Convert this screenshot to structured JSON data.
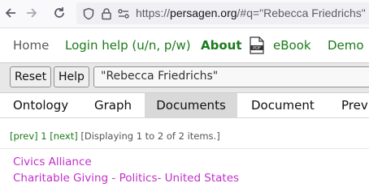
{
  "browser": {
    "url_prefix": "https://",
    "url_host": "persagen.org",
    "url_rest": "/#q=\"Rebecca Friedrichs\""
  },
  "menu": {
    "home": "Home",
    "login": "Login help (u/n, p/w)",
    "about": "About",
    "pdf_icon_text": "PDF",
    "ebook": "eBook",
    "demo": "Demo"
  },
  "search": {
    "reset_label": "Reset",
    "help_label": "Help",
    "query": "\"Rebecca Friedrichs\""
  },
  "tabs": [
    {
      "label": "Ontology"
    },
    {
      "label": "Graph"
    },
    {
      "label": "Documents",
      "active": true
    },
    {
      "label": "Document"
    },
    {
      "label": "Previ"
    }
  ],
  "pager": {
    "prev": "[prev]",
    "page": "1",
    "next": "[next]",
    "status": "[Displaying 1 to 2 of 2 items.]"
  },
  "results": [
    {
      "title": "Civics Alliance"
    },
    {
      "title": "Charitable Giving - Politics- United States"
    }
  ],
  "colors": {
    "link_green": "#1a7a1a",
    "result_magenta": "#c030c8",
    "active_tab_bg": "#d9d9d9"
  }
}
